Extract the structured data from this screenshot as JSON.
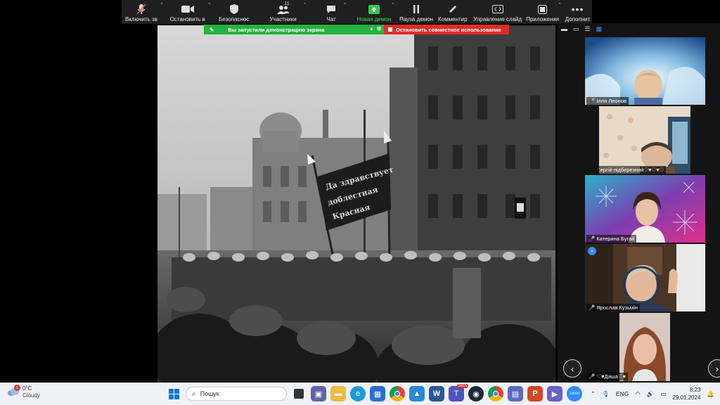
{
  "toolbar": {
    "items": [
      {
        "label": "Включить зв",
        "icon": "mic-muted-icon"
      },
      {
        "label": "Остановить в",
        "icon": "video-camera-icon"
      },
      {
        "label": "Безопаснос",
        "icon": "shield-icon"
      },
      {
        "label": "Участники",
        "icon": "participants-icon",
        "count": "11"
      },
      {
        "label": "Чат",
        "icon": "chat-icon"
      },
      {
        "label": "Новая демон",
        "icon": "share-screen-icon"
      },
      {
        "label": "Пауза демон",
        "icon": "pause-icon"
      },
      {
        "label": "Комментир",
        "icon": "annotate-icon"
      },
      {
        "label": "Управление слайд",
        "icon": "slide-control-icon"
      },
      {
        "label": "Приложения",
        "icon": "apps-icon"
      },
      {
        "label": "Дополнит",
        "icon": "more-icon"
      }
    ],
    "accent_green": "#3ddc5a"
  },
  "sharebar": {
    "status_text": "Вы запустили демонстрацию экрана",
    "stop_text": "Остановить совместное использование",
    "green": "#23b33f",
    "red": "#e02b2b"
  },
  "shared_image": {
    "banner_text_1": "Да здравствует",
    "banner_text_2": "доблестная",
    "banner_text_3": "Красная"
  },
  "gallery": {
    "participants": [
      {
        "name": "Ілля Леонов",
        "muted": true
      },
      {
        "name": "Сергій підберезний♡♥♡♥♡",
        "muted": true
      },
      {
        "name": "Катерина Бугай",
        "muted": true
      },
      {
        "name": "Ярослав Кузьмін",
        "muted": true
      },
      {
        "name": "♡♥Даша♡♥",
        "muted": true
      }
    ],
    "prev_label": "‹",
    "next_label": "›"
  },
  "taskbar": {
    "weather_temp": "0°C",
    "weather_text": "Cloudy",
    "weather_badge": "1",
    "search_placeholder": "Пошук",
    "teams_badge": "2016",
    "language": "ENG",
    "time": "8:23",
    "date": "29.01.2024"
  }
}
